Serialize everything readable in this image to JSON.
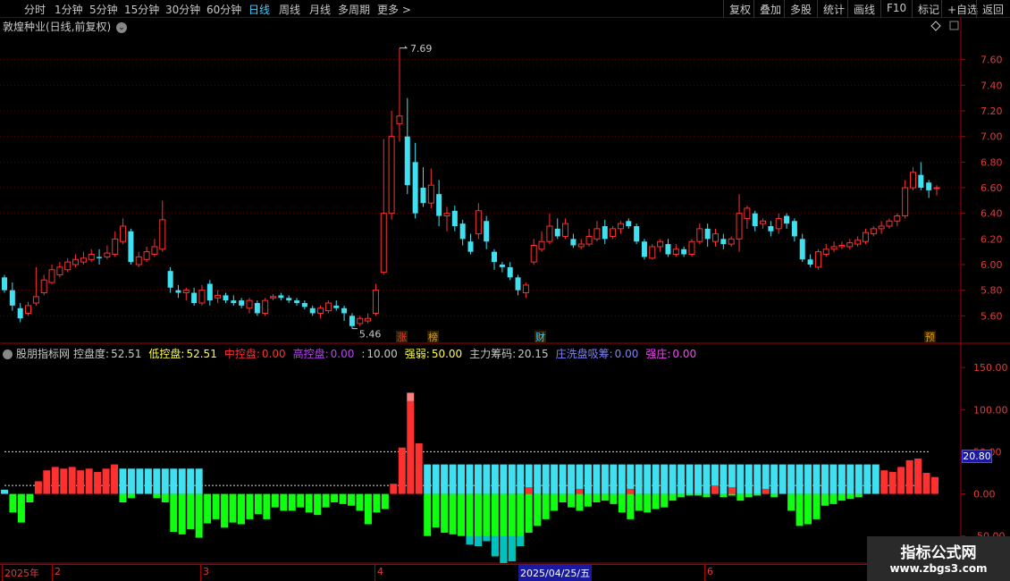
{
  "toolbar": {
    "left_items": [
      "分时",
      "1分钟",
      "5分钟",
      "15分钟",
      "30分钟",
      "60分钟",
      "日线",
      "周线",
      "月线",
      "多周期",
      "更多 >"
    ],
    "active": "日线",
    "right_items": [
      "复权",
      "叠加",
      "多股",
      "统计",
      "画线",
      "F10",
      "标记",
      "+自选",
      "返回"
    ]
  },
  "stock_title": "敦煌种业(日线,前复权)",
  "price_axis": {
    "ticks": [
      "7.60",
      "7.40",
      "7.20",
      "7.00",
      "6.80",
      "6.60",
      "6.40",
      "6.20",
      "6.00",
      "5.80",
      "5.60"
    ]
  },
  "annotations": {
    "high": "7.69",
    "low": "5.46"
  },
  "event_tags": [
    {
      "label": "涨",
      "color": "#e03c3c"
    },
    {
      "label": "榜",
      "color": "#e0a000"
    },
    {
      "label": "财",
      "color": "#3cd0ff"
    },
    {
      "label": "预",
      "color": "#e0a000"
    }
  ],
  "indicator": {
    "name": "股朋指标网",
    "fields": [
      {
        "label": "控盘度:",
        "value": "52.51",
        "color": "#c8c8c8"
      },
      {
        "label": "低控盘:",
        "value": "52.51",
        "color": "#ffff40"
      },
      {
        "label": "中控盘:",
        "value": "0.00",
        "color": "#ff3030"
      },
      {
        "label": "高控盘:",
        "value": "0.00",
        "color": "#c040ff"
      },
      {
        "label": ":",
        "value": "10.00",
        "color": "#c8c8c8"
      },
      {
        "label": "强弱:",
        "value": "50.00",
        "color": "#ffff40"
      },
      {
        "label": "主力筹码:",
        "value": "20.15",
        "color": "#c8c8c8"
      },
      {
        "label": "庄洗盘吸筹:",
        "value": "0.00",
        "color": "#8080ff"
      },
      {
        "label": "强庄:",
        "value": "0.00",
        "color": "#ff40ff"
      }
    ]
  },
  "indicator_axis": {
    "ticks": [
      "150.00",
      "100.00",
      "50.00",
      "0.00",
      "-50.00"
    ]
  },
  "current_value": "20.80",
  "dates": {
    "items": [
      "2025年",
      "2",
      "3",
      "4",
      "6"
    ],
    "selected": "2025/04/25/五"
  },
  "watermark": {
    "title": "指标公式网",
    "url": "www.zbgs3.com"
  },
  "colors": {
    "up": "#ff3030",
    "down": "#40e0f0",
    "green": "#10ff10",
    "teal": "#00c0c0",
    "pink": "#ff8080"
  },
  "chart_data": {
    "type": "candlestick",
    "price_ylim": [
      5.4,
      7.8
    ],
    "candles": [
      [
        5.9,
        5.8,
        5.92,
        5.78
      ],
      [
        5.8,
        5.68,
        5.86,
        5.64
      ],
      [
        5.66,
        5.58,
        5.7,
        5.55
      ],
      [
        5.62,
        5.68,
        5.71,
        5.6
      ],
      [
        5.7,
        5.75,
        5.98,
        5.68
      ],
      [
        5.78,
        5.88,
        5.92,
        5.76
      ],
      [
        5.86,
        5.96,
        6.0,
        5.85
      ],
      [
        5.92,
        5.98,
        6.02,
        5.9
      ],
      [
        5.96,
        6.02,
        6.05,
        5.94
      ],
      [
        6.0,
        6.04,
        6.08,
        5.98
      ],
      [
        6.02,
        6.05,
        6.1,
        6.0
      ],
      [
        6.04,
        6.08,
        6.12,
        6.02
      ],
      [
        6.06,
        6.05,
        6.12,
        6.0
      ],
      [
        6.06,
        6.09,
        6.15,
        6.04
      ],
      [
        6.08,
        6.2,
        6.26,
        6.06
      ],
      [
        6.18,
        6.3,
        6.36,
        6.16
      ],
      [
        6.26,
        6.02,
        6.28,
        6.0
      ],
      [
        6.0,
        6.06,
        6.1,
        5.98
      ],
      [
        6.04,
        6.1,
        6.14,
        6.02
      ],
      [
        6.08,
        6.14,
        6.2,
        6.06
      ],
      [
        6.12,
        6.35,
        6.5,
        6.1
      ],
      [
        5.95,
        5.82,
        5.98,
        5.78
      ],
      [
        5.8,
        5.78,
        5.84,
        5.74
      ],
      [
        5.78,
        5.8,
        5.82,
        5.72
      ],
      [
        5.78,
        5.7,
        5.82,
        5.68
      ],
      [
        5.7,
        5.8,
        5.84,
        5.68
      ],
      [
        5.85,
        5.72,
        5.88,
        5.68
      ],
      [
        5.74,
        5.76,
        5.8,
        5.7
      ],
      [
        5.76,
        5.72,
        5.78,
        5.7
      ],
      [
        5.72,
        5.7,
        5.76,
        5.68
      ],
      [
        5.72,
        5.68,
        5.74,
        5.66
      ],
      [
        5.66,
        5.72,
        5.74,
        5.62
      ],
      [
        5.7,
        5.62,
        5.72,
        5.6
      ],
      [
        5.62,
        5.72,
        5.74,
        5.6
      ],
      [
        5.74,
        5.75,
        5.77,
        5.72
      ],
      [
        5.76,
        5.74,
        5.78,
        5.72
      ],
      [
        5.74,
        5.72,
        5.76,
        5.7
      ],
      [
        5.72,
        5.7,
        5.74,
        5.68
      ],
      [
        5.7,
        5.67,
        5.72,
        5.65
      ],
      [
        5.66,
        5.62,
        5.68,
        5.6
      ],
      [
        5.62,
        5.66,
        5.68,
        5.58
      ],
      [
        5.64,
        5.7,
        5.72,
        5.62
      ],
      [
        5.68,
        5.66,
        5.72,
        5.64
      ],
      [
        5.66,
        5.62,
        5.68,
        5.56
      ],
      [
        5.6,
        5.52,
        5.62,
        5.5
      ],
      [
        5.54,
        5.58,
        5.6,
        5.52
      ],
      [
        5.56,
        5.58,
        5.62,
        5.54
      ],
      [
        5.62,
        5.8,
        5.85,
        5.6
      ],
      [
        5.94,
        6.4,
        6.98,
        5.92
      ],
      [
        6.4,
        7.0,
        7.2,
        6.35
      ],
      [
        7.1,
        7.16,
        7.69,
        6.96
      ],
      [
        7.0,
        6.62,
        7.3,
        6.55
      ],
      [
        6.8,
        6.4,
        6.95,
        6.36
      ],
      [
        6.6,
        6.48,
        6.76,
        6.45
      ],
      [
        6.48,
        6.62,
        6.75,
        6.44
      ],
      [
        6.55,
        6.38,
        6.66,
        6.3
      ],
      [
        6.38,
        6.4,
        6.45,
        6.26
      ],
      [
        6.42,
        6.3,
        6.46,
        6.26
      ],
      [
        6.32,
        6.2,
        6.35,
        6.15
      ],
      [
        6.18,
        6.1,
        6.24,
        6.08
      ],
      [
        6.24,
        6.42,
        6.48,
        6.2
      ],
      [
        6.34,
        6.18,
        6.38,
        6.12
      ],
      [
        6.1,
        6.02,
        6.12,
        5.96
      ],
      [
        6.0,
        5.98,
        6.02,
        5.94
      ],
      [
        5.98,
        5.9,
        6.02,
        5.88
      ],
      [
        5.9,
        5.8,
        5.92,
        5.76
      ],
      [
        5.78,
        5.84,
        5.86,
        5.74
      ],
      [
        6.02,
        6.15,
        6.2,
        6.0
      ],
      [
        6.12,
        6.18,
        6.26,
        6.1
      ],
      [
        6.18,
        6.3,
        6.4,
        6.16
      ],
      [
        6.28,
        6.22,
        6.36,
        6.2
      ],
      [
        6.22,
        6.32,
        6.36,
        6.2
      ],
      [
        6.2,
        6.15,
        6.24,
        6.13
      ],
      [
        6.14,
        6.16,
        6.2,
        6.12
      ],
      [
        6.16,
        6.22,
        6.28,
        6.14
      ],
      [
        6.2,
        6.28,
        6.34,
        6.18
      ],
      [
        6.3,
        6.2,
        6.35,
        6.16
      ],
      [
        6.22,
        6.28,
        6.3,
        6.2
      ],
      [
        6.28,
        6.32,
        6.34,
        6.24
      ],
      [
        6.34,
        6.3,
        6.36,
        6.28
      ],
      [
        6.3,
        6.18,
        6.32,
        6.16
      ],
      [
        6.18,
        6.06,
        6.2,
        6.04
      ],
      [
        6.05,
        6.14,
        6.16,
        6.04
      ],
      [
        6.14,
        6.18,
        6.2,
        6.1
      ],
      [
        6.16,
        6.08,
        6.2,
        6.06
      ],
      [
        6.08,
        6.12,
        6.16,
        6.06
      ],
      [
        6.12,
        6.08,
        6.14,
        6.06
      ],
      [
        6.08,
        6.18,
        6.2,
        6.06
      ],
      [
        6.18,
        6.28,
        6.32,
        6.16
      ],
      [
        6.28,
        6.2,
        6.32,
        6.14
      ],
      [
        6.18,
        6.24,
        6.28,
        6.14
      ],
      [
        6.2,
        6.16,
        6.24,
        6.12
      ],
      [
        6.16,
        6.2,
        6.22,
        6.14
      ],
      [
        6.2,
        6.4,
        6.55,
        6.1
      ],
      [
        6.36,
        6.44,
        6.46,
        6.28
      ],
      [
        6.4,
        6.3,
        6.42,
        6.26
      ],
      [
        6.32,
        6.34,
        6.36,
        6.28
      ],
      [
        6.3,
        6.26,
        6.34,
        6.22
      ],
      [
        6.28,
        6.36,
        6.4,
        6.24
      ],
      [
        6.38,
        6.32,
        6.4,
        6.28
      ],
      [
        6.34,
        6.22,
        6.36,
        6.18
      ],
      [
        6.2,
        6.04,
        6.24,
        6.02
      ],
      [
        6.04,
        6.0,
        6.08,
        5.98
      ],
      [
        5.98,
        6.1,
        6.12,
        5.96
      ],
      [
        6.08,
        6.12,
        6.16,
        6.06
      ],
      [
        6.12,
        6.14,
        6.18,
        6.1
      ],
      [
        6.14,
        6.15,
        6.18,
        6.12
      ],
      [
        6.14,
        6.17,
        6.2,
        6.12
      ],
      [
        6.16,
        6.19,
        6.22,
        6.14
      ],
      [
        6.18,
        6.25,
        6.28,
        6.16
      ],
      [
        6.24,
        6.28,
        6.3,
        6.22
      ],
      [
        6.28,
        6.3,
        6.34,
        6.24
      ],
      [
        6.3,
        6.34,
        6.36,
        6.28
      ],
      [
        6.34,
        6.38,
        6.4,
        6.3
      ],
      [
        6.38,
        6.6,
        6.66,
        6.36
      ],
      [
        6.6,
        6.72,
        6.76,
        6.58
      ],
      [
        6.7,
        6.6,
        6.8,
        6.58
      ],
      [
        6.64,
        6.58,
        6.66,
        6.52
      ],
      [
        6.6,
        6.6,
        6.62,
        6.54
      ]
    ],
    "indicator_ylim": [
      -80,
      165
    ],
    "indicator_refs": [
      50,
      10
    ],
    "indicator_bars": [
      [
        5,
        0,
        0
      ],
      [
        0,
        -22,
        0
      ],
      [
        0,
        -34,
        0
      ],
      [
        0,
        -10,
        0
      ],
      [
        15,
        0,
        0
      ],
      [
        28,
        0,
        0
      ],
      [
        32,
        0,
        0
      ],
      [
        30,
        0,
        0
      ],
      [
        32,
        0,
        0
      ],
      [
        28,
        0,
        0
      ],
      [
        30,
        0,
        0
      ],
      [
        26,
        0,
        0
      ],
      [
        30,
        0,
        0
      ],
      [
        35,
        0,
        0
      ],
      [
        30,
        -10,
        0
      ],
      [
        30,
        -5,
        0
      ],
      [
        30,
        0,
        0
      ],
      [
        30,
        0,
        0
      ],
      [
        30,
        -5,
        0
      ],
      [
        30,
        -10,
        0
      ],
      [
        30,
        -45,
        0
      ],
      [
        30,
        -48,
        0
      ],
      [
        30,
        -42,
        0
      ],
      [
        30,
        -52,
        0
      ],
      [
        0,
        -35,
        0
      ],
      [
        0,
        -30,
        0
      ],
      [
        0,
        -40,
        0
      ],
      [
        0,
        -34,
        0
      ],
      [
        0,
        -36,
        0
      ],
      [
        0,
        -30,
        0
      ],
      [
        0,
        -24,
        0
      ],
      [
        0,
        -30,
        0
      ],
      [
        0,
        -16,
        0
      ],
      [
        0,
        -20,
        0
      ],
      [
        0,
        -20,
        0
      ],
      [
        0,
        -16,
        0
      ],
      [
        0,
        -22,
        0
      ],
      [
        0,
        -25,
        0
      ],
      [
        0,
        -16,
        0
      ],
      [
        0,
        -10,
        0
      ],
      [
        0,
        -12,
        0
      ],
      [
        0,
        -14,
        0
      ],
      [
        0,
        -20,
        0
      ],
      [
        0,
        -36,
        0
      ],
      [
        0,
        -22,
        0
      ],
      [
        0,
        -18,
        0
      ],
      [
        12,
        0,
        0
      ],
      [
        55,
        0,
        0
      ],
      [
        110,
        0,
        0
      ],
      [
        60,
        0,
        0
      ],
      [
        35,
        -50,
        0
      ],
      [
        35,
        -40,
        0
      ],
      [
        35,
        -46,
        0
      ],
      [
        35,
        -48,
        0
      ],
      [
        35,
        -50,
        0
      ],
      [
        35,
        -60,
        0
      ],
      [
        35,
        -62,
        0
      ],
      [
        35,
        -56,
        0
      ],
      [
        35,
        -74,
        0
      ],
      [
        35,
        -82,
        0
      ],
      [
        35,
        -80,
        0
      ],
      [
        35,
        -62,
        0
      ],
      [
        35,
        -46,
        0
      ],
      [
        35,
        -38,
        0
      ],
      [
        35,
        -30,
        0
      ],
      [
        35,
        -20,
        0
      ],
      [
        35,
        -10,
        0
      ],
      [
        35,
        -16,
        0
      ],
      [
        35,
        -20,
        0
      ],
      [
        35,
        -15,
        0
      ],
      [
        35,
        -10,
        0
      ],
      [
        35,
        -8,
        0
      ],
      [
        35,
        -12,
        0
      ],
      [
        35,
        -22,
        0
      ],
      [
        35,
        -30,
        0
      ],
      [
        35,
        -20,
        0
      ],
      [
        35,
        -22,
        0
      ],
      [
        35,
        -18,
        0
      ],
      [
        35,
        -16,
        0
      ],
      [
        35,
        -8,
        0
      ],
      [
        35,
        -4,
        0
      ],
      [
        35,
        -2,
        0
      ],
      [
        35,
        -2,
        0
      ],
      [
        35,
        -4,
        0
      ],
      [
        35,
        0,
        0
      ],
      [
        35,
        -4,
        0
      ],
      [
        35,
        -2,
        0
      ],
      [
        35,
        -8,
        0
      ],
      [
        35,
        -4,
        0
      ],
      [
        35,
        -2,
        0
      ],
      [
        35,
        0,
        0
      ],
      [
        35,
        -4,
        0
      ],
      [
        35,
        0,
        0
      ],
      [
        35,
        -20,
        0
      ],
      [
        35,
        -38,
        0
      ],
      [
        35,
        -36,
        0
      ],
      [
        35,
        -30,
        0
      ],
      [
        35,
        -14,
        0
      ],
      [
        35,
        -12,
        0
      ],
      [
        35,
        -8,
        0
      ],
      [
        35,
        -6,
        0
      ],
      [
        35,
        -4,
        0
      ],
      [
        35,
        0,
        0
      ],
      [
        35,
        0,
        0
      ],
      [
        28,
        0,
        0
      ],
      [
        26,
        0,
        0
      ],
      [
        32,
        0,
        0
      ],
      [
        40,
        0,
        0
      ],
      [
        42,
        0,
        0
      ],
      [
        25,
        0,
        0
      ],
      [
        20,
        0,
        0
      ]
    ]
  }
}
